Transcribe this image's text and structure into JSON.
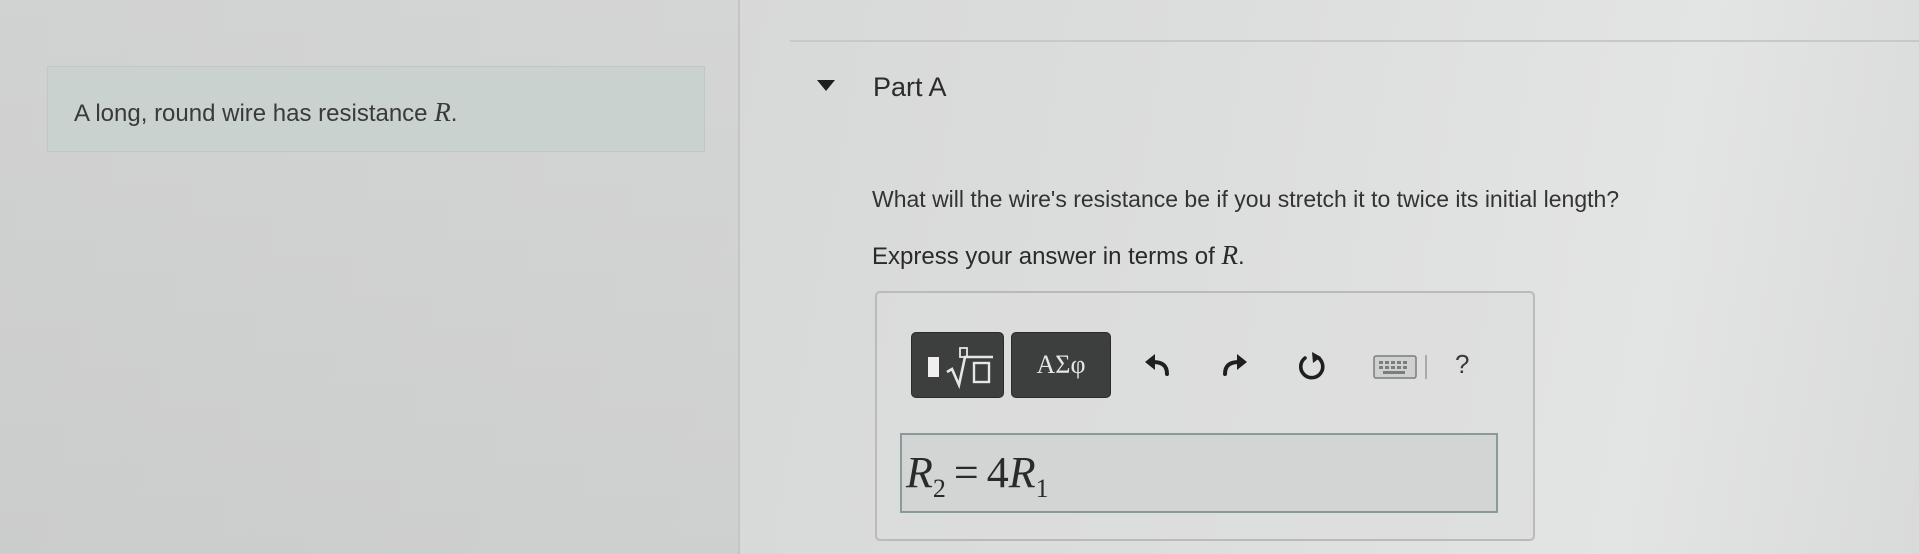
{
  "problem": {
    "intro_text": "A long, round wire has resistance",
    "intro_var": "R",
    "intro_end": "."
  },
  "part": {
    "title": "Part A",
    "question": "What will the wire's resistance be if you stretch it to twice its initial length?",
    "instruction_text": "Express your answer in terms of",
    "instruction_var": "R",
    "instruction_end": "."
  },
  "toolbar": {
    "symbols_label": "ΑΣφ",
    "help_label": "?"
  },
  "answer": {
    "lhs_var": "R",
    "lhs_sub": "2",
    "operator": "=",
    "rhs_coef": "4",
    "rhs_var": "R",
    "rhs_sub": "1"
  },
  "icons": {
    "toggle": "caret-down-icon",
    "templates": "templates-radical-icon",
    "undo": "undo-icon",
    "redo": "redo-icon",
    "reset": "reset-icon",
    "keyboard": "keyboard-icon"
  }
}
